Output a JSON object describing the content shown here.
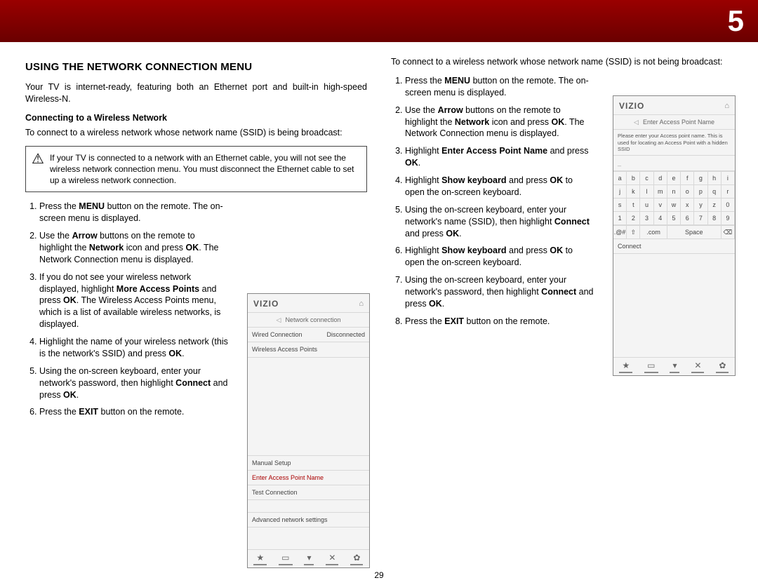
{
  "chapter_number": "5",
  "page_number": "29",
  "col1": {
    "title": "USING THE NETWORK CONNECTION MENU",
    "intro": "Your TV is internet-ready, featuring both an Ethernet port and built-in high-speed Wireless-N.",
    "sub1": "Connecting to a Wireless Network",
    "sub1_text": "To connect to a wireless network whose network name (SSID) is being broadcast:",
    "warning": "If your TV is connected to a network with an Ethernet cable, you will not see the wireless network connection menu. You must disconnect the Ethernet cable to set up a wireless network connection.",
    "last": "Press the <b>EXIT</b> button on the remote."
  },
  "col2": {
    "intro": "To connect to a wireless network whose network name (SSID) is not being broadcast:"
  },
  "fig1": {
    "logo": "VIZIO",
    "title": "Network connection",
    "row1_l": "Wired Connection",
    "row1_r": "Disconnected",
    "row2": "Wireless Access Points",
    "row3": "Manual Setup",
    "row4": "Enter Access Point Name",
    "row5": "Test Connection",
    "row6": "Advanced network settings"
  },
  "fig2": {
    "logo": "VIZIO",
    "title": "Enter Access Point Name",
    "note": "Please enter your Access point name. This is used for locating an Access Point with a hidden SSID",
    "connect": "Connect",
    "kbd_letters": [
      "a",
      "b",
      "c",
      "d",
      "e",
      "f",
      "g",
      "h",
      "i",
      "j",
      "k",
      "l",
      "m",
      "n",
      "o",
      "p",
      "q",
      "r",
      "s",
      "t",
      "u",
      "v",
      "w",
      "x",
      "y",
      "z",
      "0",
      "1",
      "2",
      "3",
      "4",
      "5",
      "6",
      "7",
      "8",
      "9"
    ],
    "sym": ".@#",
    "shift": "⇧",
    "com": ".com",
    "space": "Space",
    "del": "⌫"
  },
  "footer_icons": [
    "★",
    "▭",
    "▾",
    "✕",
    "✿"
  ]
}
